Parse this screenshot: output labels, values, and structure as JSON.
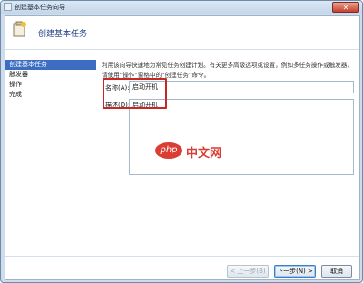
{
  "window": {
    "title": "创建基本任务向导",
    "close_glyph": "✕"
  },
  "header": {
    "title": "创建基本任务"
  },
  "sidebar": {
    "items": [
      {
        "label": "创建基本任务",
        "active": true
      },
      {
        "label": "触发器",
        "active": false
      },
      {
        "label": "操作",
        "active": false
      },
      {
        "label": "完成",
        "active": false
      }
    ]
  },
  "main": {
    "description": "利用该向导快速地为常见任务创建计划。有关更多高级选项或设置，例如多任务操作或触发器，请使用“操作”窗格中的“创建任务”命令。",
    "name_label": "名称(A):",
    "name_value": "启动开机",
    "desc_label": "描述(D):",
    "desc_value": "启动开机"
  },
  "watermark": {
    "logo": "php",
    "text": "中文网"
  },
  "footer": {
    "back": "< 上一步(B)",
    "next": "下一步(N) >",
    "cancel": "取消"
  },
  "colors": {
    "accent": "#3d6cc3",
    "highlight": "#c62828",
    "title_blue": "#1e3f8a"
  }
}
